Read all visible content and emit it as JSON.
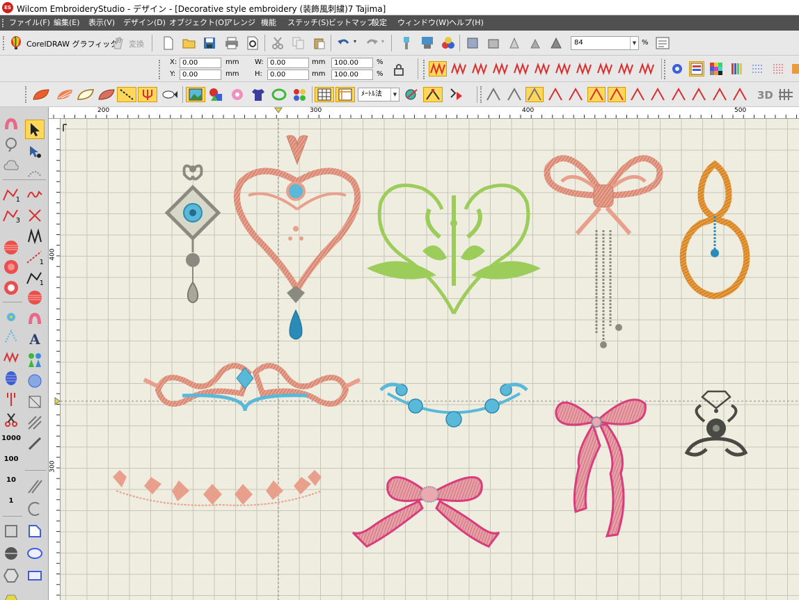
{
  "titlebar": {
    "logo": "ES",
    "title": "Wilcom EmbroideryStudio - デザイン - [Decorative style embroidery (装飾風刺繍)7      Tajima]"
  },
  "menu": [
    "ファイル(F)",
    "編集(E)",
    "表示(V)",
    "デザイン(D)",
    "オブジェクト(O)",
    "アレンジ",
    "機能",
    "ステッチ(S)",
    "ビットマップ",
    "設定",
    "ウィンドウ(W)",
    "ヘルプ(H)"
  ],
  "toolbar1": {
    "coreldraw_label": "CorelDRAW グラフィック",
    "convert_label": "変換",
    "zoom_value": "84",
    "zoom_unit": "%"
  },
  "toolbar2": {
    "x_label": "X:",
    "x_value": "0.00",
    "x_unit": "mm",
    "y_label": "Y:",
    "y_value": "0.00",
    "y_unit": "mm",
    "w_label": "W:",
    "w_value": "0.00",
    "w_unit": "mm",
    "h_label": "H:",
    "h_value": "0.00",
    "h_unit": "mm",
    "sx_value": "100.00",
    "sx_unit": "%",
    "sy_value": "100.00",
    "sy_unit": "%"
  },
  "toolbar3": {
    "unit_select": "ﾒｰﾄﾙ法",
    "threed_label": "3D"
  },
  "left_toolbar": {
    "num_1": "1",
    "num_3": "3",
    "num_1b": "1",
    "num_1c": "1",
    "letter_a": "A",
    "n1000": "1000",
    "n100": "100",
    "n10": "10",
    "n1": "1"
  },
  "ruler_top": [
    "200",
    "300",
    "400",
    "500"
  ],
  "ruler_left": [
    "400",
    "300"
  ],
  "colors": {
    "salmon": "#e8a08c",
    "teal": "#5ab8d8",
    "lime": "#9ccc5a",
    "orange": "#e89a3c",
    "magenta": "#d83c7c",
    "gray": "#8a8a80",
    "dark": "#4a4a44",
    "menu": "#505050",
    "canvas": "#efede0",
    "highlight": "#ffd75a"
  }
}
